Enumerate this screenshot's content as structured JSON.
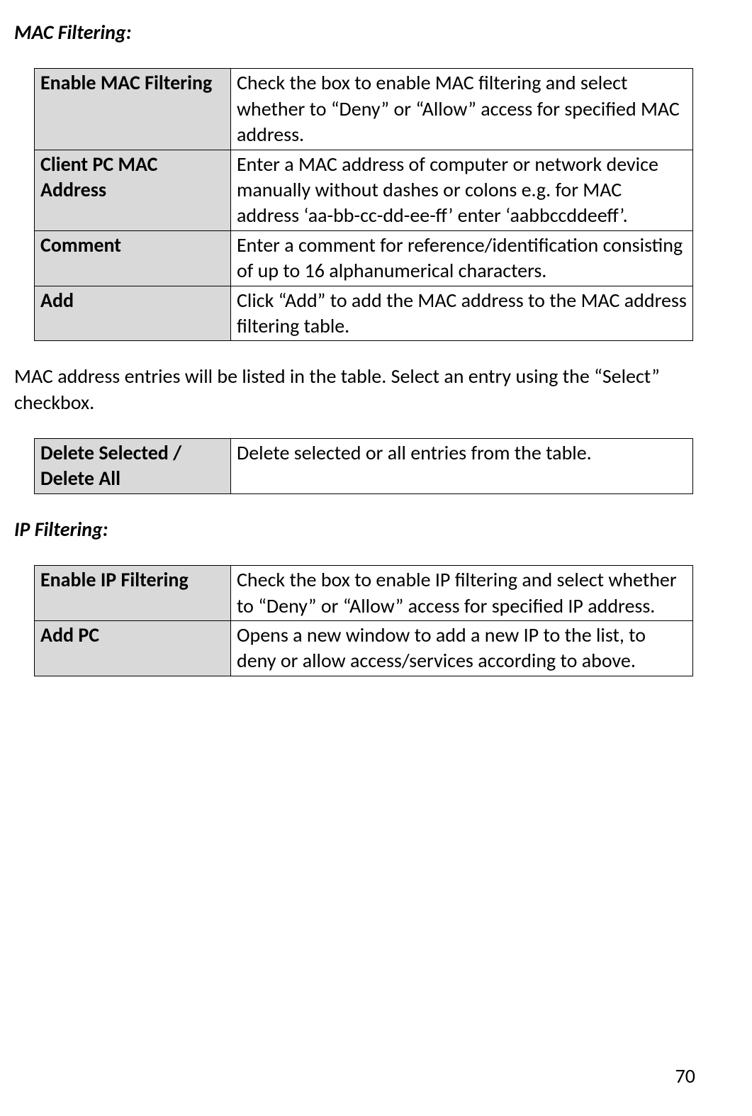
{
  "sections": {
    "mac": {
      "title": "MAC Filtering:",
      "body": "MAC address entries will be listed in the table. Select an entry using the “Select” checkbox.",
      "table1": [
        {
          "label": "Enable MAC Filtering",
          "desc": "Check the box to enable MAC filtering and select whether to “Deny” or “Allow” access for specified MAC address."
        },
        {
          "label": "Client PC MAC Address",
          "desc": "Enter a MAC address of computer or network device manually without dashes or colons e.g. for MAC address ‘aa-bb-cc-dd-ee-ff’ enter ‘aabbccddeeff’."
        },
        {
          "label": "Comment",
          "desc": "Enter a comment for reference/identification consisting of up to 16 alphanumerical characters."
        },
        {
          "label": "Add",
          "desc": "Click “Add” to add the MAC address to the MAC address filtering table."
        }
      ],
      "table2": [
        {
          "label": "Delete Selected / Delete All",
          "desc": "Delete selected or all entries from the table."
        }
      ]
    },
    "ip": {
      "title": "IP Filtering:",
      "table": [
        {
          "label": "Enable IP Filtering",
          "desc": "Check the box to enable IP filtering and select whether to “Deny” or “Allow” access for specified IP address."
        },
        {
          "label": "Add PC",
          "desc": "Opens a new window to add a new IP to the list, to deny or allow access/services according to above."
        }
      ]
    }
  },
  "page_number": "70"
}
